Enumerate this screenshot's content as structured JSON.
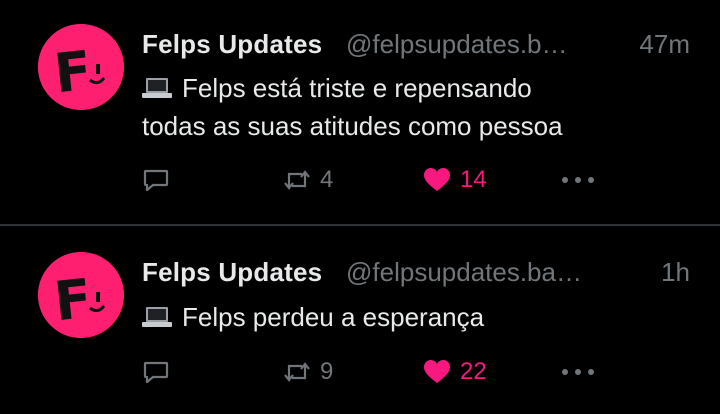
{
  "tweets": [
    {
      "author_name": "Felps Updates",
      "handle": "@felpsupdates.b…",
      "time": "47m",
      "text_lines": [
        "Felps está triste e repensando",
        "todas as suas atitudes como pessoa"
      ],
      "text_prefix_icon": "laptop-icon",
      "retweets": "4",
      "likes": "14",
      "avatar_letter": "F"
    },
    {
      "author_name": "Felps Updates",
      "handle": "@felpsupdates.ba…",
      "time": "1h",
      "text_lines": [
        "Felps perdeu a esperança"
      ],
      "text_prefix_icon": "laptop-icon",
      "retweets": "9",
      "likes": "22",
      "avatar_letter": "F"
    }
  ],
  "colors": {
    "background": "#000000",
    "text_primary": "#e7e9ea",
    "text_secondary": "#71767b",
    "like_active": "#f91880",
    "avatar_bg": "#ff1f70",
    "divider": "#2f3336"
  },
  "icons": {
    "reply": "reply-icon",
    "retweet": "retweet-icon",
    "like": "heart-icon",
    "more": "more-icon"
  }
}
